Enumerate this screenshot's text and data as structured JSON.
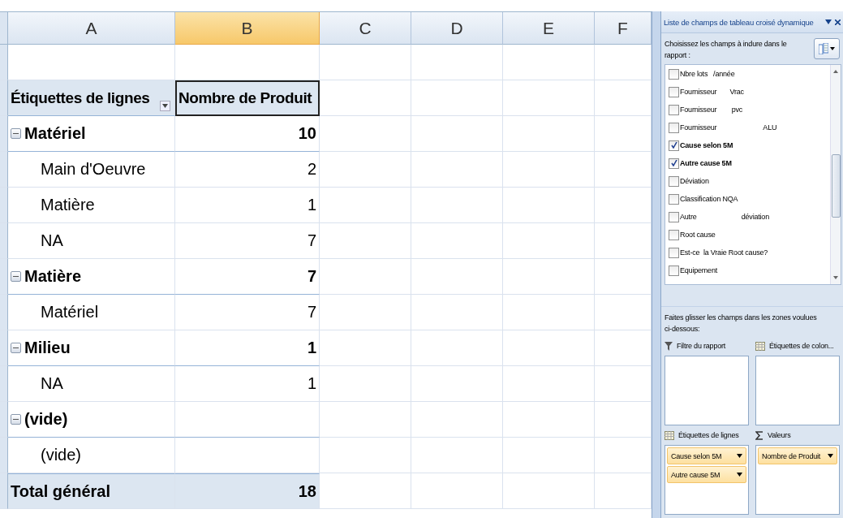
{
  "sheet": {
    "columns": [
      {
        "label": "A",
        "selected": false
      },
      {
        "label": "B",
        "selected": true
      },
      {
        "label": "C",
        "selected": false
      },
      {
        "label": "D",
        "selected": false
      },
      {
        "label": "E",
        "selected": false
      },
      {
        "label": "F",
        "selected": false
      }
    ],
    "rows": [
      {
        "kind": "blank"
      },
      {
        "kind": "header",
        "label": "Étiquettes de lignes",
        "value": "Nombre de Produit"
      },
      {
        "kind": "group",
        "label": "Matériel",
        "value": "10",
        "expanded": true
      },
      {
        "kind": "item",
        "label": "Main d'Oeuvre",
        "value": "2"
      },
      {
        "kind": "item",
        "label": "Matière",
        "value": "1"
      },
      {
        "kind": "item",
        "label": "NA",
        "value": "7"
      },
      {
        "kind": "group",
        "label": "Matière",
        "value": "7",
        "expanded": true
      },
      {
        "kind": "item",
        "label": "Matériel",
        "value": "7"
      },
      {
        "kind": "group",
        "label": "Milieu",
        "value": "1",
        "expanded": true
      },
      {
        "kind": "item",
        "label": "NA",
        "value": "1"
      },
      {
        "kind": "group",
        "label": "(vide)",
        "value": "",
        "expanded": true
      },
      {
        "kind": "item",
        "label": "(vide)",
        "value": ""
      },
      {
        "kind": "total",
        "label": "Total général",
        "value": "18"
      }
    ]
  },
  "field_list": {
    "title": "Liste de champs de tableau croisé dynamique",
    "instruction": "Choisissez les champs à indure dans le rapport :",
    "fields": [
      {
        "label": "Nbre lots   /année",
        "checked": false
      },
      {
        "label": "Fournisseur       Vrac",
        "checked": false
      },
      {
        "label": "Fournisseur        pvc",
        "checked": false
      },
      {
        "label": "Fournisseur                         ALU",
        "checked": false
      },
      {
        "label": "Cause selon 5M",
        "checked": true
      },
      {
        "label": "Autre cause 5M",
        "checked": true
      },
      {
        "label": "Déviation",
        "checked": false
      },
      {
        "label": "Classification NQA",
        "checked": false
      },
      {
        "label": "Autre                        déviation",
        "checked": false
      },
      {
        "label": "Root cause",
        "checked": false
      },
      {
        "label": "Est-ce  la Vraie Root cause?",
        "checked": false
      },
      {
        "label": "Equipement",
        "checked": false
      }
    ],
    "drag_hint": "Faites glisser les champs dans les zones voulues ci-dessous:",
    "areas": [
      {
        "kind": "filter",
        "label": "Filtre du rapport"
      },
      {
        "kind": "columns",
        "label": "Étiquettes de colon..."
      },
      {
        "kind": "rows",
        "label": "Étiquettes de lignes",
        "chips": [
          "Cause selon 5M",
          "Autre cause 5M"
        ]
      },
      {
        "kind": "values",
        "label": "Valeurs",
        "chips": [
          "Nombre de Produit"
        ]
      }
    ]
  }
}
